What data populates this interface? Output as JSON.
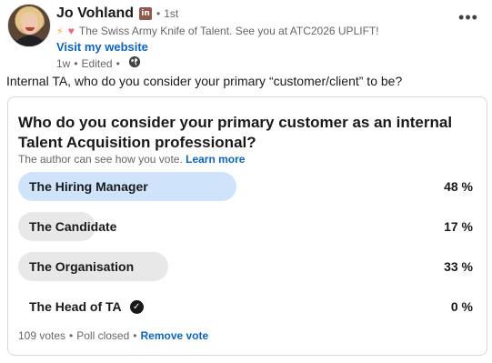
{
  "author": {
    "name": "Jo Vohland",
    "badge": "in",
    "degree_separator": "•",
    "degree": "1st",
    "headline": "The Swiss Army Knife of Talent. See you at ATC2026 UPLIFT!",
    "website_link": "Visit my website",
    "time": "1w",
    "meta_separator": "•",
    "edited": "Edited",
    "meta_separator2": "•"
  },
  "more_menu": "•••",
  "commentary": "Internal TA, who do you consider your primary “customer/client” to be?",
  "poll": {
    "question": "Who do you consider your primary customer as an internal Talent Acquisition professional?",
    "vote_note": "The author can see how you vote.",
    "learn_more": "Learn more",
    "options": [
      {
        "label": "The Hiring Manager",
        "percent_label": "48 %",
        "percent": 48,
        "selected": true
      },
      {
        "label": "The Candidate",
        "percent_label": "17 %",
        "percent": 17,
        "selected": false
      },
      {
        "label": "The Organisation",
        "percent_label": "33 %",
        "percent": 33,
        "selected": false
      },
      {
        "label": "The Head of TA",
        "percent_label": "0 %",
        "percent": 0,
        "selected": false,
        "voted": true
      }
    ],
    "votes": "109 votes",
    "status": "Poll closed",
    "remove_vote": "Remove vote",
    "footer_separator": "•",
    "footer_separator2": "•"
  },
  "colors": {
    "link": "#0a66c2",
    "bar": "#e8e8e8",
    "bar_selected": "#cfe4fb"
  },
  "icons": [
    "avatar",
    "linkedin-badge-icon",
    "lightning-icon",
    "heart-icon",
    "globe-icon",
    "more-icon",
    "check-circle-icon"
  ]
}
